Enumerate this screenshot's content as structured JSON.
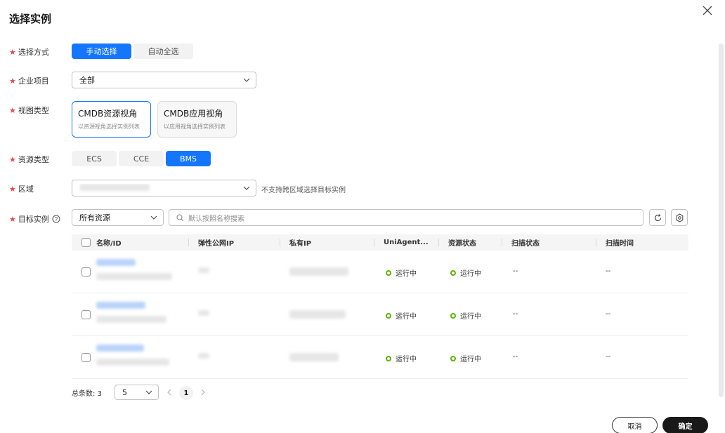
{
  "dialog": {
    "title": "选择实例"
  },
  "labels": {
    "select_mode": "选择方式",
    "enterprise_project": "企业项目",
    "view_type": "视图类型",
    "resource_type": "资源类型",
    "region": "区域",
    "target_instance": "目标实例"
  },
  "select_mode": {
    "options": [
      "手动选择",
      "自动全选"
    ],
    "selected": "手动选择"
  },
  "enterprise_project": {
    "value": "全部"
  },
  "view_cards": [
    {
      "title": "CMDB资源视角",
      "subtitle": "以资源视角选择实例列表",
      "selected": true
    },
    {
      "title": "CMDB应用视角",
      "subtitle": "以应用视角选择实例列表",
      "selected": false
    }
  ],
  "resource_type": {
    "options": [
      "ECS",
      "CCE",
      "BMS"
    ],
    "selected": "BMS"
  },
  "region": {
    "hint": "不支持跨区域选择目标实例"
  },
  "target": {
    "filter_value": "所有资源",
    "search_placeholder": "默认按照名称搜索"
  },
  "table": {
    "headers": [
      "名称/ID",
      "弹性公网IP",
      "私有IP",
      "UniAgent...",
      "资源状态",
      "扫描状态",
      "扫描时间"
    ],
    "rows": [
      {
        "uniagent": "运行中",
        "resource_status": "运行中",
        "scan_status": "--",
        "scan_time": "--"
      },
      {
        "uniagent": "运行中",
        "resource_status": "运行中",
        "scan_status": "--",
        "scan_time": "--"
      },
      {
        "uniagent": "运行中",
        "resource_status": "运行中",
        "scan_status": "--",
        "scan_time": "--"
      }
    ]
  },
  "pagination": {
    "total_label": "总条数:",
    "total": "3",
    "page_size": "5",
    "current_page": "1"
  },
  "footer": {
    "cancel": "取消",
    "confirm": "确定"
  },
  "colors": {
    "primary": "#1476ff",
    "required": "#e5484d",
    "status_ok": "#5cb300"
  }
}
